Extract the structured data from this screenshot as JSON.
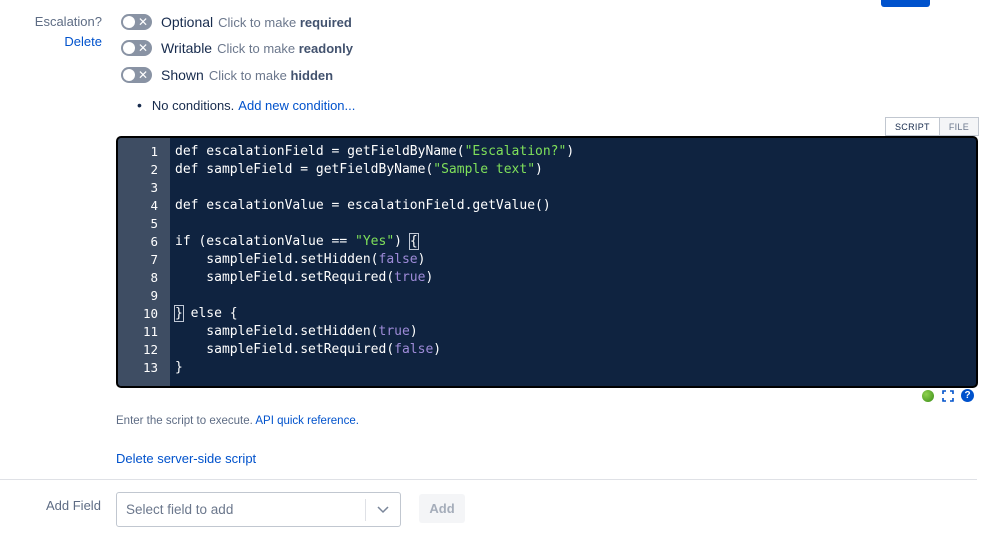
{
  "field": {
    "name": "Escalation?",
    "delete_label": "Delete"
  },
  "toggles": [
    {
      "state": "Optional",
      "hint_prefix": "Click to make",
      "hint_target": "required"
    },
    {
      "state": "Writable",
      "hint_prefix": "Click to make",
      "hint_target": "readonly"
    },
    {
      "state": "Shown",
      "hint_prefix": "Click to make",
      "hint_target": "hidden"
    }
  ],
  "conditions": {
    "text": "No conditions.",
    "link": "Add new condition..."
  },
  "editor": {
    "tabs": [
      "SCRIPT",
      "FILE"
    ],
    "line_numbers": [
      "1",
      "2",
      "3",
      "4",
      "5",
      "6",
      "7",
      "8",
      "9",
      "10",
      "11",
      "12",
      "13"
    ],
    "code": {
      "l1_a": "def escalationField = getFieldByName(",
      "l1_s": "\"Escalation?\"",
      "l1_b": ")",
      "l2_a": "def sampleField = getFieldByName(",
      "l2_s": "\"Sample text\"",
      "l2_b": ")",
      "l4": "def escalationValue = escalationField.getValue()",
      "l6_a": "if (escalationValue == ",
      "l6_s": "\"Yes\"",
      "l6_b": ") ",
      "l6_c": "{",
      "l7_a": "    sampleField.setHidden(",
      "l7_k": "false",
      "l7_b": ")",
      "l8_a": "    sampleField.setRequired(",
      "l8_k": "true",
      "l8_b": ")",
      "l10_c": "}",
      "l10_a": " else {",
      "l11_a": "    sampleField.setHidden(",
      "l11_k": "true",
      "l11_b": ")",
      "l12_a": "    sampleField.setRequired(",
      "l12_k": "false",
      "l12_b": ")",
      "l13": "}"
    }
  },
  "status": {
    "ok_icon": "green-status-dot",
    "expand_icon": "fullscreen-icon",
    "help_icon": "help-icon",
    "help_glyph": "?"
  },
  "note": {
    "text": "Enter the script to execute.",
    "link": "API quick reference."
  },
  "delete_script": "Delete server-side script",
  "add_field": {
    "label": "Add Field",
    "placeholder": "Select field to add",
    "button": "Add"
  },
  "colors": {
    "accent": "#0052cc",
    "editor_bg": "#0f2340",
    "string": "#7fe05a",
    "literal": "#9e8bd8"
  }
}
